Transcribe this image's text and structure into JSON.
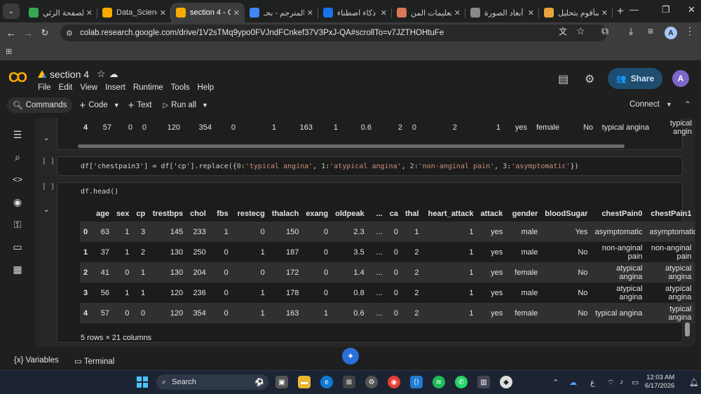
{
  "browser": {
    "tabs": [
      {
        "title": "الصفحة الرئي",
        "icon": "google-drive-icon",
        "color": "#34a853"
      },
      {
        "title": "Data_Scienc",
        "icon": "colab-icon",
        "color": "#f9ab00"
      },
      {
        "title": "section 4 - C",
        "icon": "colab-icon",
        "color": "#f9ab00",
        "active": true
      },
      {
        "title": "المترجم - بحـ",
        "icon": "google-icon",
        "color": "#4285f4"
      },
      {
        "title": "ذكاء اصطناء",
        "icon": "ai-icon",
        "color": "#1a73e8"
      },
      {
        "title": "تعليمات المن",
        "icon": "claude-icon",
        "color": "#d97757"
      },
      {
        "title": "أبعاد الصورة",
        "icon": "chatgpt-icon",
        "color": "#888888"
      },
      {
        "title": "سأقوم بتحليل",
        "icon": "bookmark-icon",
        "color": "#e8a33d"
      }
    ],
    "url": "colab.research.google.com/drive/1V2sTMq9ypo0FVJndFCnkef37V3PxJ-QA#scrollTo=v7JZTHOHtuFe",
    "profile_initial": "A"
  },
  "colab": {
    "doc_title": "section 4",
    "menu": [
      "File",
      "Edit",
      "View",
      "Insert",
      "Runtime",
      "Tools",
      "Help"
    ],
    "share_label": "Share",
    "avatar_initial": "A",
    "toolbar": {
      "commands": "Commands",
      "code": "Code",
      "text": "Text",
      "run_all": "Run all",
      "connect": "Connect"
    }
  },
  "cells": {
    "prev_row": [
      "4",
      "57",
      "0",
      "0",
      "120",
      "354",
      "0",
      "1",
      "163",
      "1",
      "0.6",
      "2",
      "0",
      "2",
      "1",
      "yes",
      "female",
      "No",
      "typical angina",
      "typical angin"
    ],
    "code1": {
      "bracket": "[ ]",
      "parts": [
        "df['chestpain3'] = df['cp'].replace({",
        "0",
        ":",
        "'typical angina'",
        ", ",
        "1",
        ":",
        "'atypical angina'",
        ", ",
        "2",
        ":",
        "'non-anginal pain'",
        ", ",
        "3",
        ":",
        "'asymptomatic'",
        "})"
      ]
    },
    "code2": {
      "bracket": "[ ]",
      "source": "df.head()"
    },
    "output": {
      "columns": [
        "",
        "age",
        "sex",
        "cp",
        "trestbps",
        "chol",
        "fbs",
        "restecg",
        "thalach",
        "exang",
        "oldpeak",
        "...",
        "ca",
        "thal",
        "heart_attack",
        "attack",
        "gender",
        "bloodSugar",
        "chestPain0",
        "chestPain1"
      ],
      "rows": [
        [
          "0",
          "63",
          "1",
          "3",
          "145",
          "233",
          "1",
          "0",
          "150",
          "0",
          "2.3",
          "...",
          "0",
          "1",
          "1",
          "yes",
          "male",
          "Yes",
          "asymptomatic",
          "asymptomatic"
        ],
        [
          "1",
          "37",
          "1",
          "2",
          "130",
          "250",
          "0",
          "1",
          "187",
          "0",
          "3.5",
          "...",
          "0",
          "2",
          "1",
          "yes",
          "male",
          "No",
          "non-anginal pain",
          "non-anginal pain"
        ],
        [
          "2",
          "41",
          "0",
          "1",
          "130",
          "204",
          "0",
          "0",
          "172",
          "0",
          "1.4",
          "...",
          "0",
          "2",
          "1",
          "yes",
          "female",
          "No",
          "atypical angina",
          "atypical angina"
        ],
        [
          "3",
          "56",
          "1",
          "1",
          "120",
          "236",
          "0",
          "1",
          "178",
          "0",
          "0.8",
          "...",
          "0",
          "2",
          "1",
          "yes",
          "male",
          "No",
          "atypical angina",
          "atypical angina"
        ],
        [
          "4",
          "57",
          "0",
          "0",
          "120",
          "354",
          "0",
          "1",
          "163",
          "1",
          "0.6",
          "...",
          "0",
          "2",
          "1",
          "yes",
          "female",
          "No",
          "typical angina",
          "typical angina"
        ]
      ],
      "shape": "5 rows × 21 columns"
    }
  },
  "bottom": {
    "variables": "Variables",
    "terminal": "Terminal"
  },
  "taskbar": {
    "search": "Search",
    "time": "12:03 AM",
    "date": "6/17/2026",
    "lang": "ع"
  }
}
